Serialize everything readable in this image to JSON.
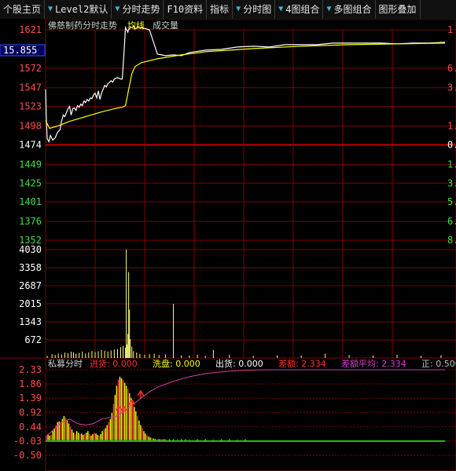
{
  "toolbar": {
    "items": [
      {
        "label": "个股主页",
        "arrow": false
      },
      {
        "label": "Level2默认",
        "arrow": true
      },
      {
        "label": "分时走势",
        "arrow": true
      },
      {
        "label": "F10资料",
        "arrow": false
      },
      {
        "label": "指标",
        "arrow": false
      },
      {
        "label": "分时图",
        "arrow": true
      },
      {
        "label": "4图组合",
        "arrow": true
      },
      {
        "label": "多图组合",
        "arrow": true
      },
      {
        "label": "图形叠加",
        "arrow": false
      }
    ]
  },
  "price_panel": {
    "title": "佛慈制药分时走势",
    "legend_avg": "均线",
    "legend_vol": "成交量",
    "current_price": "15.855",
    "y_labels_up": [
      "1621",
      "1572",
      "1547",
      "1523",
      "1498"
    ],
    "y_label_base": "1474",
    "y_labels_down": [
      "1449",
      "1425",
      "1401",
      "1376",
      "1352"
    ],
    "right_labels_up": [
      "1",
      "6.",
      "3.",
      "1."
    ],
    "right_label_base": "0.",
    "right_labels_down": [
      "1.",
      "3.",
      "5.",
      "6.",
      "8."
    ]
  },
  "volume_panel": {
    "y_labels": [
      "4030",
      "3358",
      "2687",
      "2015",
      "1343",
      "672"
    ]
  },
  "indicator_panel": {
    "name": "私募分时",
    "fields": [
      {
        "label": "进货:",
        "value": "0.000",
        "color": "#ff3030"
      },
      {
        "label": "洗盘:",
        "value": "0.000",
        "color": "#ffff00"
      },
      {
        "label": "出货:",
        "value": "0.000",
        "color": "#ffffff"
      },
      {
        "label": "差额:",
        "value": "2.334",
        "color": "#ff3030"
      },
      {
        "label": "差额平均:",
        "value": "2.334",
        "color": "#d040d0"
      },
      {
        "label": "正:",
        "value": "0.500",
        "color": "#c0c0c0"
      }
    ],
    "y_labels": [
      "2.33",
      "1.86",
      "1.39",
      "0.92",
      "0.44",
      "-0.03",
      "-0.50"
    ]
  },
  "chart_data": {
    "type": "line",
    "price_series": {
      "t": [
        0,
        1,
        2,
        4,
        6,
        9,
        12,
        15,
        18,
        20,
        22,
        24,
        26,
        28,
        30,
        32,
        34,
        36,
        38,
        40,
        42,
        44,
        46,
        48,
        50,
        52,
        54,
        56,
        58,
        60,
        62,
        64,
        66,
        68,
        70,
        72,
        74,
        76,
        78,
        80,
        82,
        84,
        86,
        88,
        90,
        92,
        94,
        96,
        98,
        100,
        101,
        102,
        103,
        104,
        105,
        106,
        107,
        108,
        109,
        110,
        112,
        115,
        120,
        130,
        140,
        150,
        160,
        170,
        180,
        200,
        220,
        240,
        260,
        280,
        300,
        320,
        340,
        360,
        380,
        400,
        420,
        440,
        460,
        480,
        500
      ],
      "v": [
        1545,
        1505,
        1482,
        1478,
        1486,
        1480,
        1483,
        1490,
        1493,
        1504,
        1512,
        1510,
        1515,
        1520,
        1523,
        1512,
        1520,
        1521,
        1518,
        1524,
        1522,
        1526,
        1524,
        1530,
        1528,
        1532,
        1530,
        1534,
        1533,
        1538,
        1540,
        1534,
        1543,
        1532,
        1540,
        1545,
        1550,
        1548,
        1552,
        1554,
        1556,
        1554,
        1558,
        1559,
        1560,
        1559,
        1558,
        1558,
        1590,
        1624,
        1622,
        1620,
        1618,
        1622,
        1622,
        1624,
        1624,
        1624,
        1624,
        1626,
        1622,
        1624,
        1624,
        1621,
        1590,
        1588,
        1589,
        1588,
        1592,
        1595,
        1596,
        1599,
        1600,
        1599,
        1602,
        1602,
        1602,
        1604,
        1604,
        1604,
        1604,
        1603,
        1604,
        1604,
        1605
      ]
    },
    "avg_series": {
      "t": [
        0,
        5,
        15,
        30,
        50,
        70,
        90,
        96,
        100,
        104,
        108,
        112,
        120,
        140,
        170,
        200,
        260,
        320,
        380,
        440,
        500
      ],
      "v": [
        1505,
        1495,
        1498,
        1504,
        1510,
        1516,
        1521,
        1522,
        1524,
        1545,
        1565,
        1574,
        1579,
        1584,
        1589,
        1593,
        1597,
        1600,
        1602,
        1603,
        1604
      ]
    },
    "volume_bars": {
      "t": [
        2,
        8,
        12,
        16,
        20,
        24,
        28,
        32,
        35,
        38,
        42,
        46,
        50,
        54,
        58,
        62,
        66,
        70,
        74,
        78,
        82,
        86,
        90,
        94,
        97,
        100,
        101,
        102,
        103,
        104,
        105,
        106,
        108,
        110,
        114,
        118,
        124,
        130,
        136,
        142,
        150,
        160,
        170,
        180,
        190,
        200,
        210,
        230,
        260,
        290,
        320,
        350,
        380,
        410,
        440,
        470,
        495
      ],
      "v": [
        80,
        140,
        110,
        160,
        130,
        200,
        180,
        230,
        210,
        160,
        190,
        240,
        170,
        210,
        260,
        220,
        250,
        300,
        270,
        240,
        280,
        320,
        330,
        400,
        450,
        380,
        4030,
        500,
        900,
        3200,
        1800,
        700,
        420,
        250,
        200,
        150,
        120,
        140,
        160,
        110,
        130,
        2010,
        100,
        90,
        120,
        80,
        300,
        120,
        80,
        100,
        90,
        160,
        110,
        90,
        120,
        80,
        100
      ]
    },
    "indicator_bars": {
      "t": [
        1,
        3,
        5,
        7,
        9,
        11,
        13,
        15,
        17,
        19,
        21,
        23,
        25,
        27,
        29,
        31,
        33,
        35,
        37,
        39,
        41,
        43,
        45,
        47,
        49,
        51,
        53,
        55,
        57,
        59,
        61,
        63,
        65,
        67,
        69,
        71,
        73,
        75,
        77,
        79,
        81,
        83,
        85,
        87,
        89,
        91,
        93,
        95,
        97,
        99,
        101,
        103,
        105,
        107,
        109,
        111,
        113,
        115,
        117,
        119,
        121,
        123,
        125,
        127,
        129,
        131,
        133,
        135,
        137,
        139,
        141,
        143,
        145,
        147,
        149,
        151,
        155,
        160,
        165,
        170,
        175,
        180,
        190,
        200,
        210,
        220,
        230,
        240,
        250
      ],
      "v": [
        0.1,
        0.2,
        0.15,
        0.18,
        0.3,
        0.4,
        0.5,
        0.6,
        0.62,
        0.55,
        0.7,
        0.8,
        0.75,
        0.65,
        0.55,
        0.45,
        0.35,
        0.25,
        0.2,
        0.3,
        0.25,
        0.2,
        0.22,
        0.18,
        0.2,
        0.25,
        0.3,
        0.2,
        0.15,
        0.2,
        0.25,
        0.22,
        0.18,
        0.15,
        0.2,
        0.3,
        0.35,
        0.4,
        0.5,
        0.6,
        0.7,
        0.9,
        1.2,
        1.5,
        1.8,
        2.0,
        2.1,
        2.05,
        2.0,
        1.9,
        1.8,
        1.7,
        1.55,
        1.4,
        1.25,
        1.1,
        0.95,
        0.8,
        0.65,
        0.5,
        0.4,
        0.3,
        0.22,
        0.16,
        0.12,
        0.09,
        0.07,
        0.05,
        0.04,
        0.03,
        0.03,
        0.03,
        0.03,
        0.03,
        0.03,
        0.03,
        0.03,
        0.03,
        0.03,
        0.03,
        0.03,
        0.03,
        0.03,
        0.03,
        0.03,
        0.03,
        0.03,
        0.03,
        0.03
      ]
    },
    "indicator_line": {
      "t": [
        0,
        10,
        20,
        30,
        40,
        50,
        60,
        70,
        80,
        90,
        100,
        110,
        120,
        130,
        140,
        160,
        180,
        200,
        220,
        240,
        260,
        280,
        300,
        330,
        360,
        400,
        440,
        480,
        500
      ],
      "v": [
        0.1,
        0.35,
        0.6,
        0.7,
        0.55,
        0.5,
        0.55,
        0.7,
        0.75,
        0.8,
        1.0,
        1.2,
        1.4,
        1.6,
        1.75,
        1.95,
        2.1,
        2.2,
        2.26,
        2.3,
        2.32,
        2.33,
        2.33,
        2.33,
        2.33,
        2.33,
        2.33,
        2.33,
        2.33
      ]
    },
    "price_range": [
      1352,
      1621
    ],
    "base_price": 1474,
    "volume_max": 4030,
    "indicator_range": [
      -0.5,
      2.33
    ],
    "time_span": [
      0,
      500
    ],
    "colors": {
      "price_line": "#ffffff",
      "avg_line": "#ffff00",
      "grid": "#800000",
      "base_line": "#c00000",
      "up_label": "#ff4b4b",
      "down_label": "#40e040",
      "volume": "#ffff80",
      "indicator_bar": "#ffff00",
      "indicator_line": "#d040a0"
    }
  }
}
